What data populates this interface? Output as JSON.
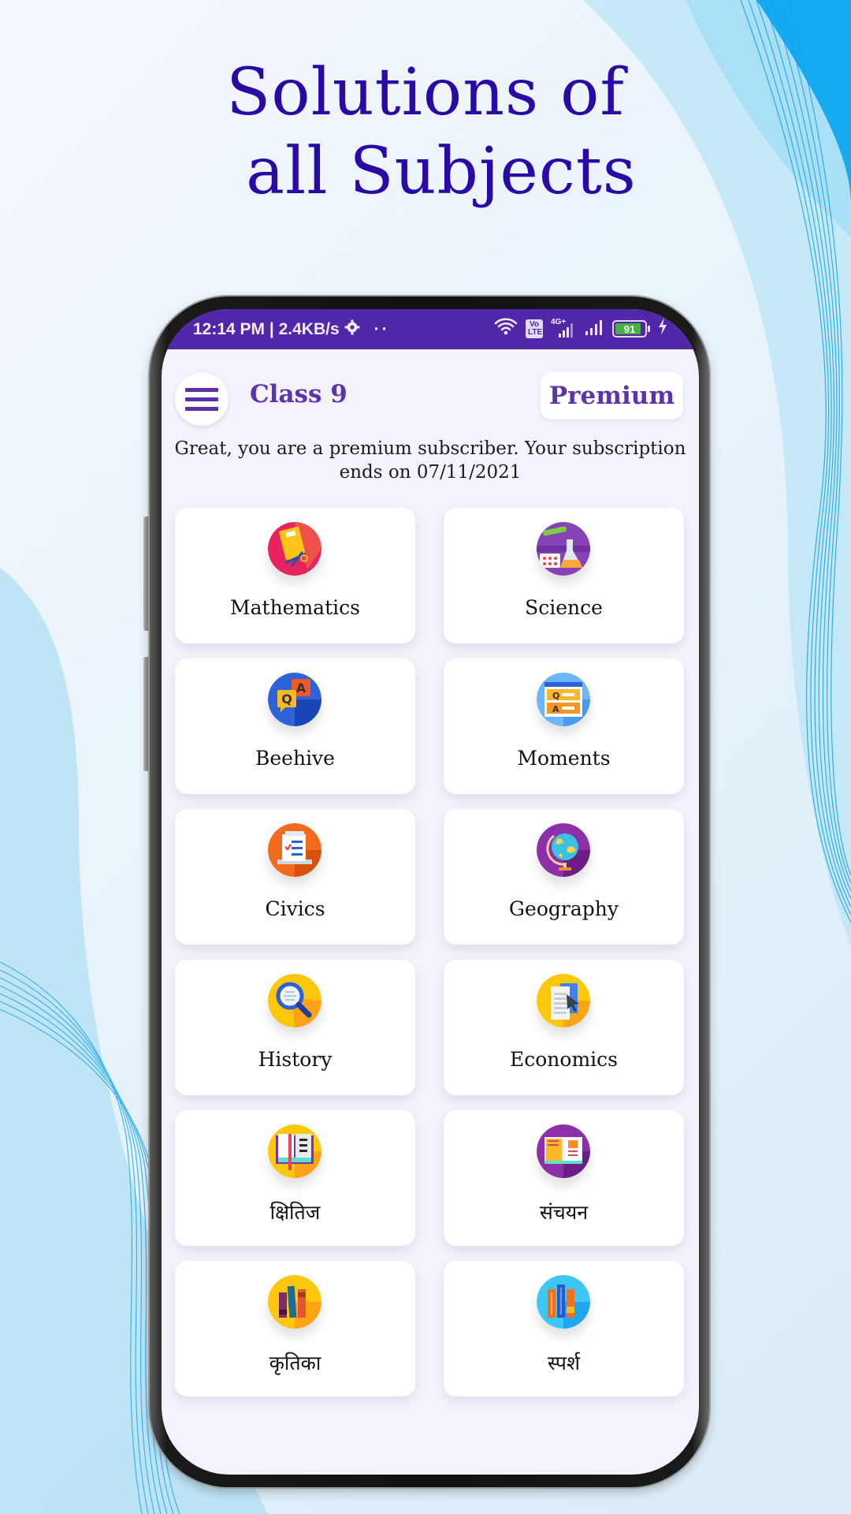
{
  "headline": {
    "line1": "Solutions of",
    "line2": "all Subjects",
    "color": "#2a0aa6"
  },
  "status_bar": {
    "time_speed": "12:14 PM | 2.4KB/s",
    "icons": [
      "settings-icon",
      "more-dots-icon",
      "wifi-icon",
      "volte-icon",
      "signal-4g-icon",
      "signal-icon",
      "battery-icon",
      "charging-icon"
    ],
    "network_label": "4G+",
    "volte_label": "Vo LTE",
    "battery_level": "91",
    "background": "#5027a9"
  },
  "app_header": {
    "menu_icon": "hamburger-menu-icon",
    "title": "Class 9",
    "premium_label": "Premium",
    "accent": "#5b34ad"
  },
  "subscription": {
    "message": "Great, you are a premium subscriber. Your subscription ends on  07/11/2021"
  },
  "subjects": [
    {
      "label": "Mathematics",
      "icon": "math-book-icon"
    },
    {
      "label": "Science",
      "icon": "science-lab-icon"
    },
    {
      "label": "Beehive",
      "icon": "qa-chat-icon"
    },
    {
      "label": "Moments",
      "icon": "qa-board-icon"
    },
    {
      "label": "Civics",
      "icon": "checklist-icon"
    },
    {
      "label": "Geography",
      "icon": "globe-icon"
    },
    {
      "label": "History",
      "icon": "magnifier-icon"
    },
    {
      "label": "Economics",
      "icon": "document-cursor-icon"
    },
    {
      "label": "क्षितिज",
      "icon": "open-book-icon"
    },
    {
      "label": "संचयन",
      "icon": "open-book-purple-icon"
    },
    {
      "label": "कृतिका",
      "icon": "books-shelf-icon"
    },
    {
      "label": "स्पर्श",
      "icon": "books-blue-icon"
    }
  ]
}
